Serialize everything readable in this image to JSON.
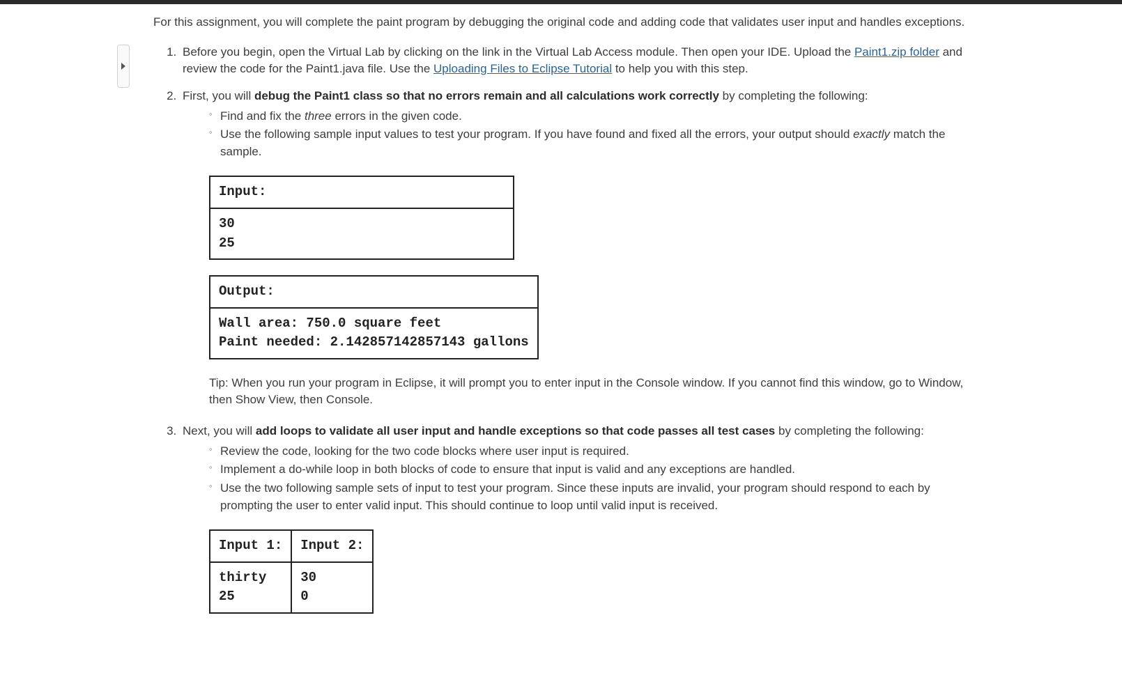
{
  "intro": "For this assignment, you will complete the paint program by debugging the original code and adding code that validates user input and handles exceptions.",
  "item1": {
    "pre_link": "Before you begin, open the Virtual Lab by clicking on the link in the Virtual Lab Access module. Then open your IDE. Upload the ",
    "link1": "Paint1.zip folder",
    "mid": " and review the code for the Paint1.java file. Use the ",
    "link2": "Uploading Files to Eclipse Tutorial",
    "post": " to help you with this step."
  },
  "item2": {
    "lead_pre": "First, you will ",
    "lead_bold": "debug the Paint1 class so that no errors remain and all calculations work correctly",
    "lead_post": " by completing the following:",
    "bullet_a_pre": "Find and fix the ",
    "bullet_a_em": "three",
    "bullet_a_post": " errors in the given code.",
    "bullet_b_pre": "Use the following sample input values to test your program. If you have found and fixed all the errors, your output should ",
    "bullet_b_em": "exactly",
    "bullet_b_post": " match the sample."
  },
  "table1": {
    "header": "Input:",
    "body": "30\n25"
  },
  "table2": {
    "header": "Output:",
    "body": "Wall area: 750.0 square feet\nPaint needed: 2.142857142857143 gallons"
  },
  "tip": "Tip: When you run your program in Eclipse, it will prompt you to enter input in the Console window. If you cannot find this window, go to Window, then Show View, then Console.",
  "item3": {
    "lead_pre": "Next, you will ",
    "lead_bold": "add loops to validate all user input and handle exceptions so that code passes all test cases",
    "lead_post": " by completing the following:",
    "bullet_a": "Review the code, looking for the two code blocks where user input is required.",
    "bullet_b": "Implement a do-while loop in both blocks of code to ensure that input is valid and any exceptions are handled.",
    "bullet_c": "Use the two following sample sets of input to test your program. Since these inputs are invalid, your program should respond to each by prompting the user to enter valid input. This should continue to loop until valid input is received."
  },
  "table3": {
    "h1": "Input 1:",
    "h2": "Input 2:",
    "c1": "thirty\n25",
    "c2": "30\n0"
  }
}
